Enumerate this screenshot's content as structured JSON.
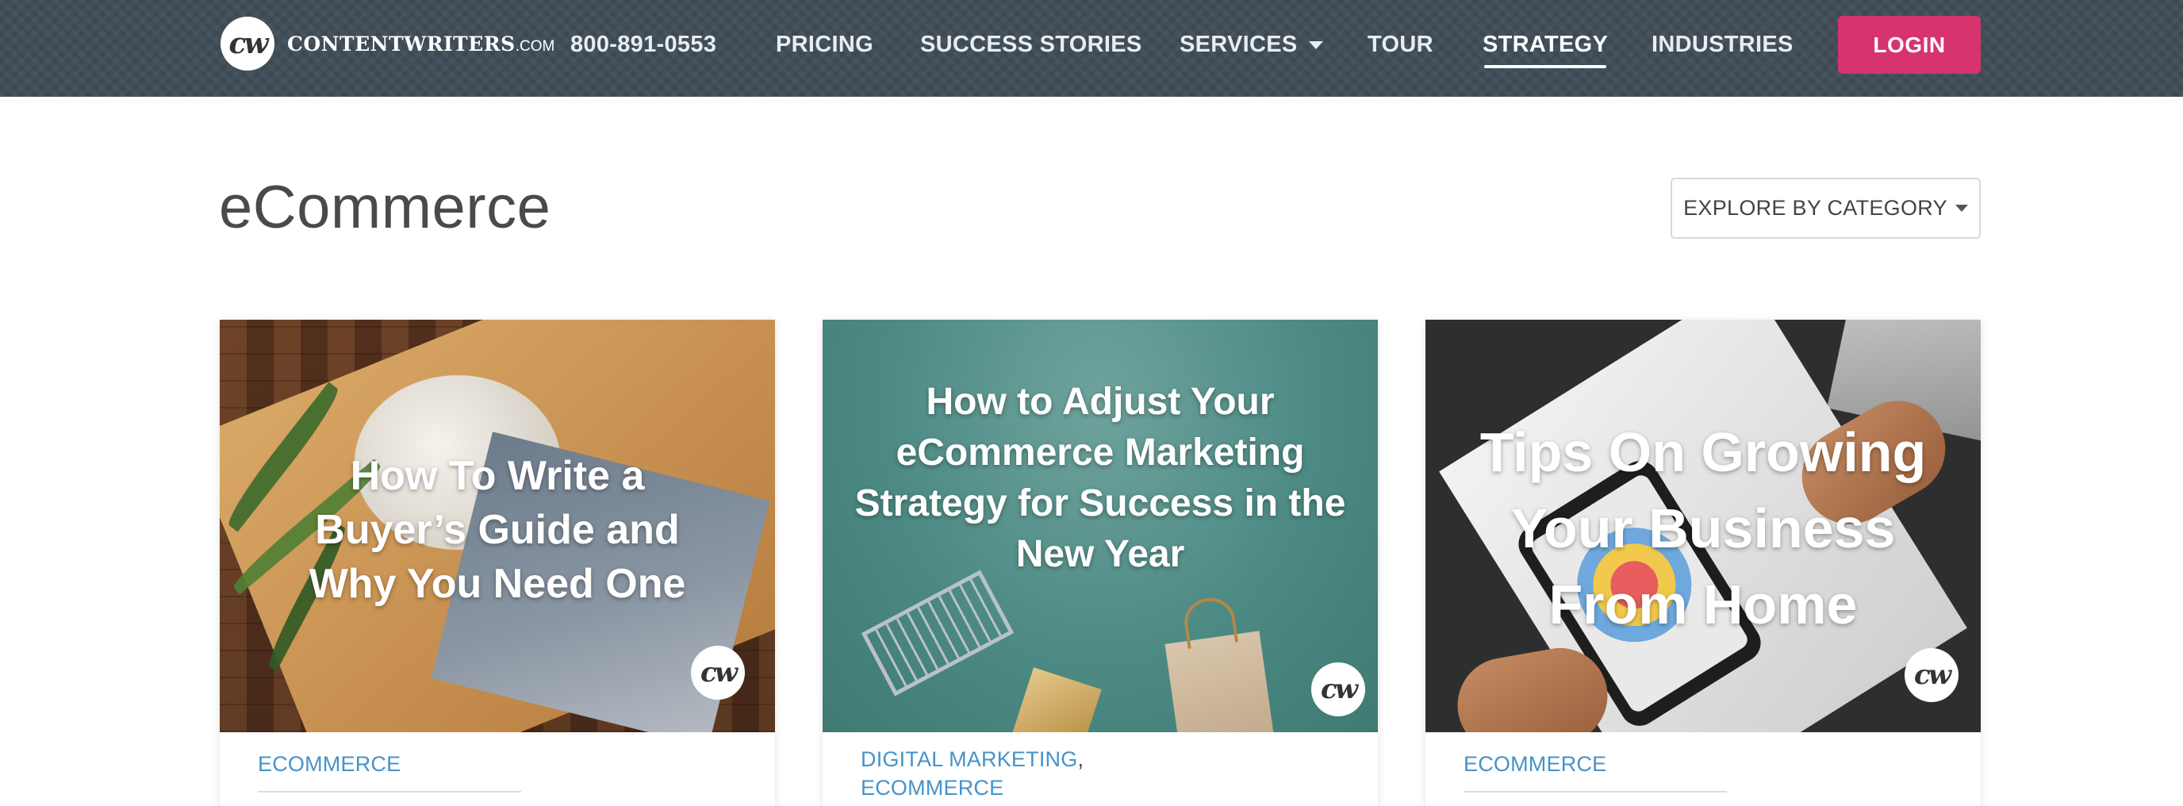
{
  "brand": {
    "badge": "cw",
    "name": "CONTENTWRITERS",
    "suffix": ".COM"
  },
  "nav": {
    "phone": "800-891-0553",
    "pricing": "PRICING",
    "success_stories": "SUCCESS STORIES",
    "services": "SERVICES",
    "tour": "TOUR",
    "strategy": "STRATEGY",
    "industries": "INDUSTRIES",
    "login": "LOGIN",
    "active_item": "STRATEGY"
  },
  "header": {
    "title": "eCommerce",
    "explore": "EXPLORE BY CATEGORY"
  },
  "colors": {
    "navbar": "#3f4c56",
    "login_button": "#d6336f",
    "category_link": "#4593c9"
  },
  "cards": [
    {
      "image_title": "How To Write a Buyer’s Guide and Why You Need One",
      "badge": "cw",
      "categories": [
        "ECOMMERCE"
      ]
    },
    {
      "image_title": "How to Adjust Your eCommerce Marketing Strategy for Success in the New Year",
      "badge": "cw",
      "categories": [
        "DIGITAL MARKETING",
        "ECOMMERCE"
      ],
      "separator": ","
    },
    {
      "image_title": "Tips On Growing Your Business From Home",
      "badge": "cw",
      "categories": [
        "ECOMMERCE"
      ]
    }
  ]
}
